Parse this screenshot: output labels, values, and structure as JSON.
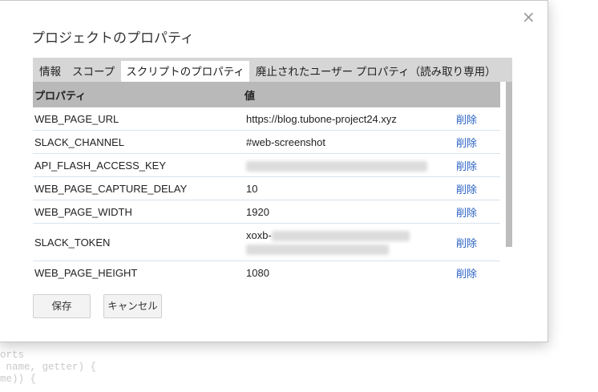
{
  "background_code": [
    "orts",
    " name, getter) {",
    "me)) {"
  ],
  "dialog": {
    "title": "プロジェクトのプロパティ",
    "close_glyph": "×"
  },
  "tabs": [
    {
      "label": "情報",
      "active": false
    },
    {
      "label": "スコープ",
      "active": false
    },
    {
      "label": "スクリプトのプロパティ",
      "active": true
    },
    {
      "label": "廃止されたユーザー プロパティ（読み取り専用）",
      "active": false
    }
  ],
  "table": {
    "headers": [
      "プロパティ",
      "値"
    ],
    "delete_label": "削除",
    "rows": [
      {
        "name": "WEB_PAGE_URL",
        "value": "https://blog.tubone-project24.xyz"
      },
      {
        "name": "SLACK_CHANNEL",
        "value": "#web-screenshot"
      },
      {
        "name": "API_FLASH_ACCESS_KEY",
        "value": ""
      },
      {
        "name": "WEB_PAGE_CAPTURE_DELAY",
        "value": "10"
      },
      {
        "name": "WEB_PAGE_WIDTH",
        "value": "1920"
      },
      {
        "name": "SLACK_TOKEN",
        "value": "xoxb-"
      },
      {
        "name": "WEB_PAGE_HEIGHT",
        "value": "1080"
      }
    ]
  },
  "buttons": {
    "save": "保存",
    "cancel": "キャンセル"
  },
  "colors": {
    "link": "#2a62c4",
    "header_bg": "#b9b9b9",
    "tabbar_bg": "#d6d6d6"
  }
}
